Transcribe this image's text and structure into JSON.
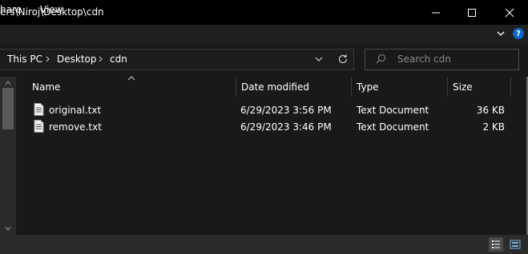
{
  "window": {
    "title": "ers\\Niroj\\Desktop\\cdn"
  },
  "ribbon": {
    "tabs": [
      "hare",
      "View"
    ],
    "help_label": "?"
  },
  "address": {
    "crumbs": [
      "This PC",
      "Desktop",
      "cdn"
    ],
    "search_placeholder": "Search cdn"
  },
  "columns": {
    "name": "Name",
    "date": "Date modified",
    "type": "Type",
    "size": "Size"
  },
  "files": [
    {
      "name": "original.txt",
      "date": "6/29/2023 3:56 PM",
      "type": "Text Document",
      "size": "36 KB"
    },
    {
      "name": "remove.txt",
      "date": "6/29/2023 3:46 PM",
      "type": "Text Document",
      "size": "2 KB"
    }
  ],
  "colors": {
    "background": "#191919",
    "titlebar": "#000000",
    "help_blue": "#0a69c7"
  }
}
